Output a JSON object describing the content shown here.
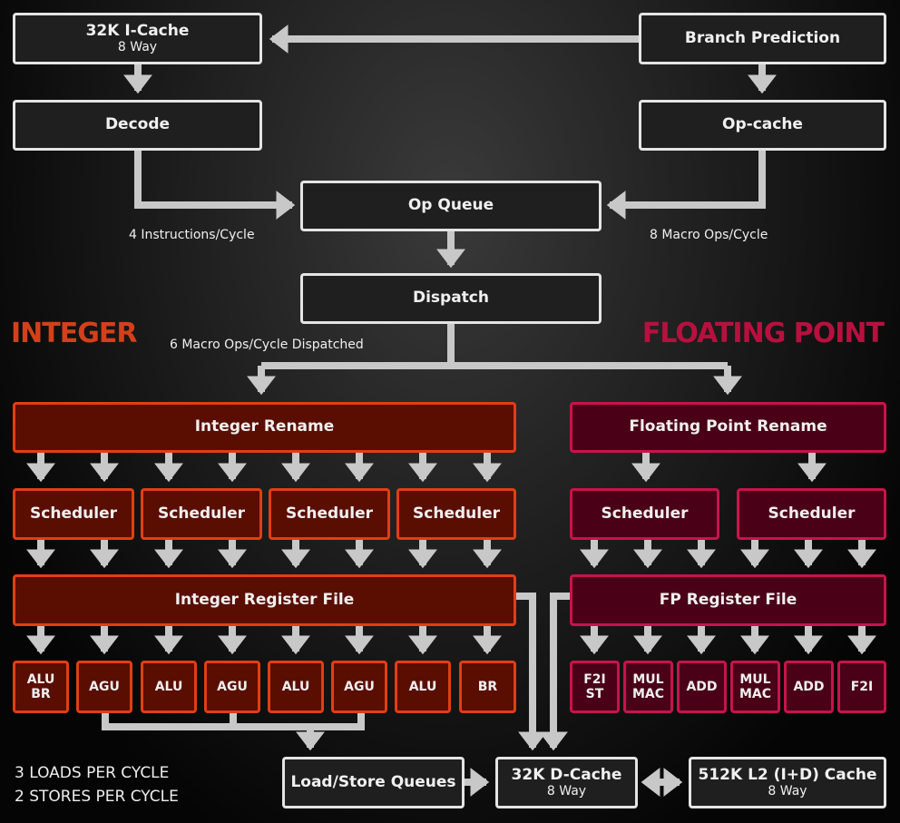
{
  "frontend": {
    "icache": {
      "title": "32K I-Cache",
      "sub": "8 Way"
    },
    "branch_prediction": "Branch Prediction",
    "decode": "Decode",
    "op_cache": "Op-cache",
    "op_queue": "Op Queue",
    "dispatch": "Dispatch",
    "decode_rate": "4 Instructions/Cycle",
    "opcache_rate": "8 Macro Ops/Cycle",
    "dispatch_rate": "6 Macro Ops/Cycle Dispatched"
  },
  "integer": {
    "heading": "INTEGER",
    "heading_color": "#d4401a",
    "rename": "Integer Rename",
    "schedulers": [
      "Scheduler",
      "Scheduler",
      "Scheduler",
      "Scheduler"
    ],
    "register_file": "Integer Register File",
    "units": [
      [
        "ALU",
        "BR"
      ],
      [
        "AGU"
      ],
      [
        "ALU"
      ],
      [
        "AGU"
      ],
      [
        "ALU"
      ],
      [
        "AGU"
      ],
      [
        "ALU"
      ],
      [
        "BR"
      ]
    ]
  },
  "floating_point": {
    "heading": "FLOATING POINT",
    "heading_color": "#b8103e",
    "rename": "Floating Point Rename",
    "schedulers": [
      "Scheduler",
      "Scheduler"
    ],
    "register_file": "FP Register File",
    "units": [
      [
        "F2I",
        "ST"
      ],
      [
        "MUL",
        "MAC"
      ],
      [
        "ADD"
      ],
      [
        "MUL",
        "MAC"
      ],
      [
        "ADD"
      ],
      [
        "F2I"
      ]
    ]
  },
  "memory": {
    "load_store": "Load/Store Queues",
    "dcache": {
      "title": "32K D-Cache",
      "sub": "8 Way"
    },
    "l2": {
      "title": "512K L2 (I+D) Cache",
      "sub": "8 Way"
    },
    "loads": "3 LOADS PER CYCLE",
    "stores": "2 STORES PER CYCLE"
  }
}
